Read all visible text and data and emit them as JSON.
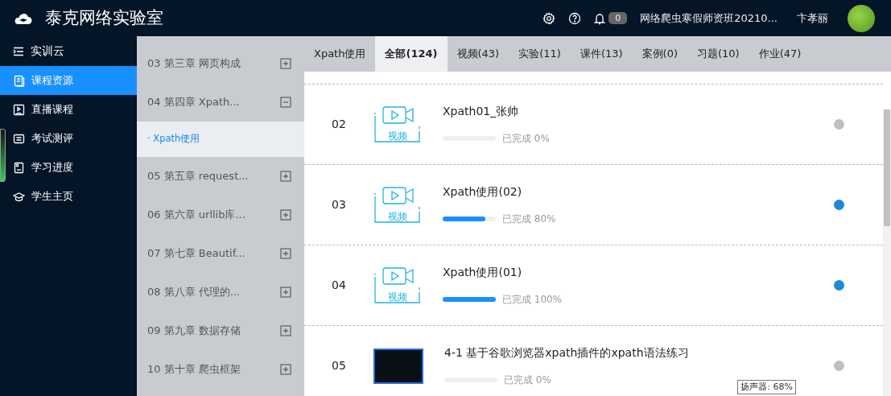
{
  "header": {
    "title": "泰克网络实验室",
    "notification_count": "0",
    "class_name": "网络爬虫寒假师资班20210...",
    "user_name": "卞孝丽"
  },
  "sidebar": {
    "title": "实训云",
    "items": [
      {
        "label": "课程资源",
        "selected": true
      },
      {
        "label": "直播课程",
        "selected": false
      },
      {
        "label": "考试测评",
        "selected": false
      },
      {
        "label": "学习进度",
        "selected": false
      },
      {
        "label": "学生主页",
        "selected": false
      }
    ]
  },
  "chapters": [
    {
      "label": "03 第三章 网页构成",
      "expanded": false
    },
    {
      "label": "04 第四章 Xpath...",
      "expanded": true,
      "children": [
        {
          "label": "· Xpath使用",
          "selected": true
        }
      ]
    },
    {
      "label": "05 第五章 request...",
      "expanded": false
    },
    {
      "label": "06 第六章 urllib库...",
      "expanded": false
    },
    {
      "label": "07 第七章 Beautif...",
      "expanded": false
    },
    {
      "label": "08 第八章 代理的...",
      "expanded": false
    },
    {
      "label": "09 第九章 数据存储",
      "expanded": false
    },
    {
      "label": "10 第十章 爬虫框架",
      "expanded": false
    }
  ],
  "tabs": [
    {
      "label": "Xpath使用",
      "selected": false
    },
    {
      "label": "全部(124)",
      "selected": true
    },
    {
      "label": "视频(43)",
      "selected": false
    },
    {
      "label": "实验(11)",
      "selected": false
    },
    {
      "label": "课件(13)",
      "selected": false
    },
    {
      "label": "案例(0)",
      "selected": false
    },
    {
      "label": "习题(10)",
      "selected": false
    },
    {
      "label": "作业(47)",
      "selected": false
    }
  ],
  "resources": [
    {
      "number": "02",
      "kind": "video",
      "type_label": "视频",
      "title": "Xpath01_张帅",
      "level": 0,
      "progress_text": "已完成 0%",
      "color": "#c0c0c0"
    },
    {
      "number": "03",
      "kind": "video",
      "type_label": "视频",
      "title": "Xpath使用(02)",
      "level": 0.8,
      "progress_text": "已完成 80%",
      "color": "#1a8ad9"
    },
    {
      "number": "04",
      "kind": "video",
      "type_label": "视频",
      "title": "Xpath使用(01)",
      "level": 1,
      "progress_text": "已完成 100%",
      "color": "#1a8ad9"
    },
    {
      "number": "05",
      "kind": "screenshot",
      "title": "4-1 基于谷歌浏览器xpath插件的xpath语法练习",
      "level": 0,
      "progress_text": "已完成 0%",
      "color": "#c0c0c0"
    }
  ],
  "tooltip": "扬声器: 68%"
}
